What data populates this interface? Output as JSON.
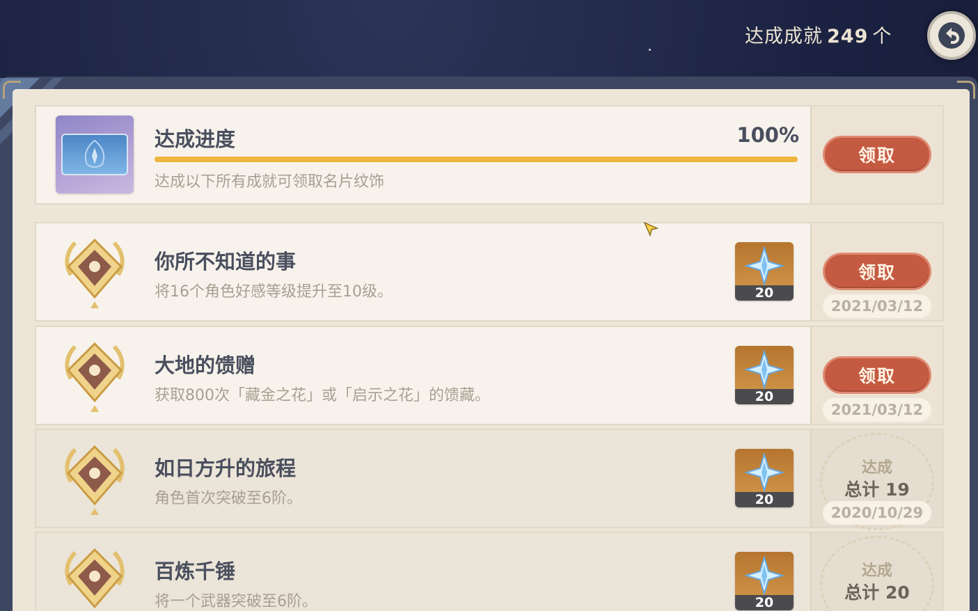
{
  "header": {
    "count_label": "达成成就",
    "count_value": "249",
    "count_unit": "个",
    "back_icon": "back-arrow-icon"
  },
  "progress": {
    "title": "达成进度",
    "percent_text": "100%",
    "progress_fraction": 1.0,
    "description": "达成以下所有成就可领取名片纹饰",
    "claim_label": "领取"
  },
  "achievements": [
    {
      "title": "你所不知道的事",
      "description": "将16个角色好感等级提升至10级。",
      "reward_qty": "20",
      "claim_label": "领取",
      "date": "2021/03/12"
    },
    {
      "title": "大地的馈赠",
      "description": "获取800次「藏金之花」或「启示之花」的馈藏。",
      "reward_qty": "20",
      "claim_label": "领取",
      "date": "2021/03/12"
    },
    {
      "title": "如日方升的旅程",
      "description": "角色首次突破至6阶。",
      "reward_qty": "20",
      "seal_line1": "达成",
      "seal_line2": "总计 19",
      "date": "2020/10/29"
    },
    {
      "title": "百炼千锤",
      "description": "将一个武器突破至6阶。",
      "reward_qty": "20",
      "seal_line1": "达成",
      "seal_line2": "总计 20"
    }
  ],
  "colors": {
    "claim_button": "#c55a42",
    "progress_bar": "#f0b53d",
    "panel": "#ece5d8"
  }
}
